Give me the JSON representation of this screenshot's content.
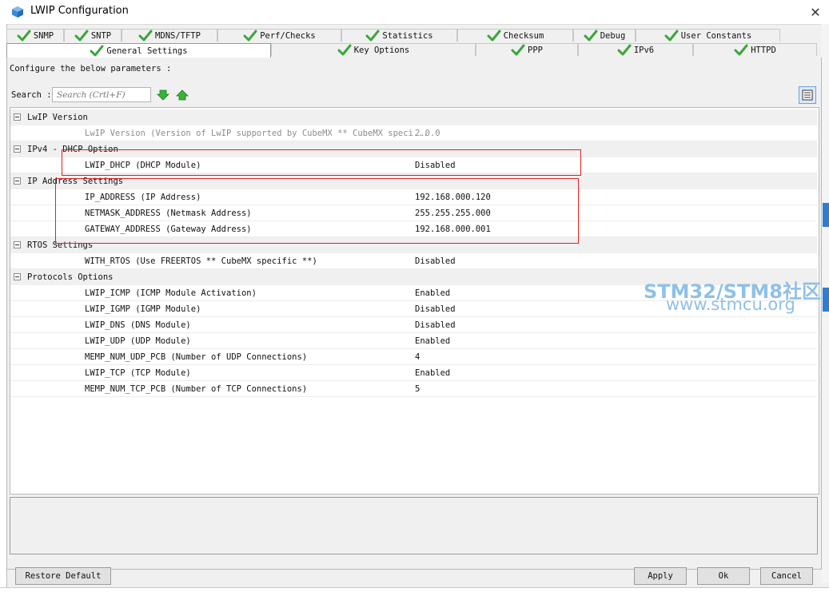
{
  "window": {
    "title": "LWIP Configuration",
    "close_glyph": "✕"
  },
  "tabs_row1": [
    {
      "label": "SNMP",
      "checked": true
    },
    {
      "label": "SNTP",
      "checked": true
    },
    {
      "label": "MDNS/TFTP",
      "checked": true
    },
    {
      "label": "Perf/Checks",
      "checked": true
    },
    {
      "label": "Statistics",
      "checked": true
    },
    {
      "label": "Checksum",
      "checked": true
    },
    {
      "label": "Debug",
      "checked": true
    },
    {
      "label": "User Constants",
      "checked": true
    }
  ],
  "tabs_row2": [
    {
      "label": "General Settings",
      "checked": true,
      "active": true
    },
    {
      "label": "Key Options",
      "checked": true
    },
    {
      "label": "PPP",
      "checked": true
    },
    {
      "label": "IPv6",
      "checked": true
    },
    {
      "label": "HTTPD",
      "checked": true
    }
  ],
  "configure_text": "Configure the below parameters :",
  "search": {
    "label": "Search :",
    "placeholder": "Search (Crtl+F)"
  },
  "groups": [
    {
      "name": "LwIP Version",
      "items": [
        {
          "name": "LwIP Version (Version of LwIP supported by CubeMX ** CubeMX speci...",
          "value": "2.0.0",
          "dim": true
        }
      ]
    },
    {
      "name": "IPv4 - DHCP Option",
      "items": [
        {
          "name": "LWIP_DHCP (DHCP Module)",
          "value": "Disabled"
        }
      ]
    },
    {
      "name": "IP Address Settings",
      "items": [
        {
          "name": "IP_ADDRESS (IP Address)",
          "value": "192.168.000.120"
        },
        {
          "name": "NETMASK_ADDRESS (Netmask Address)",
          "value": "255.255.255.000"
        },
        {
          "name": "GATEWAY_ADDRESS (Gateway Address)",
          "value": "192.168.000.001"
        }
      ]
    },
    {
      "name": "RTOS Settings",
      "items": [
        {
          "name": "WITH_RTOS (Use FREERTOS ** CubeMX specific **)",
          "value": "Disabled"
        }
      ]
    },
    {
      "name": "Protocols Options",
      "items": [
        {
          "name": "LWIP_ICMP (ICMP Module Activation)",
          "value": "Enabled"
        },
        {
          "name": "LWIP_IGMP (IGMP Module)",
          "value": "Disabled"
        },
        {
          "name": "LWIP_DNS (DNS Module)",
          "value": "Disabled"
        },
        {
          "name": "LWIP_UDP (UDP Module)",
          "value": "Enabled"
        },
        {
          "name": "MEMP_NUM_UDP_PCB (Number of UDP Connections)",
          "value": "4"
        },
        {
          "name": "LWIP_TCP (TCP Module)",
          "value": "Enabled"
        },
        {
          "name": "MEMP_NUM_TCP_PCB (Number of TCP Connections)",
          "value": "5"
        }
      ]
    }
  ],
  "watermark": {
    "line1": "STM32/STM8社区",
    "line2": "www.stmcu.org"
  },
  "buttons": {
    "restore": "Restore Default",
    "apply": "Apply",
    "ok": "Ok",
    "cancel": "Cancel"
  },
  "colors": {
    "check": "#3aa63a",
    "arrow": "#39b339",
    "highlight": "#e02020",
    "watermark": "#8fc0e8"
  }
}
